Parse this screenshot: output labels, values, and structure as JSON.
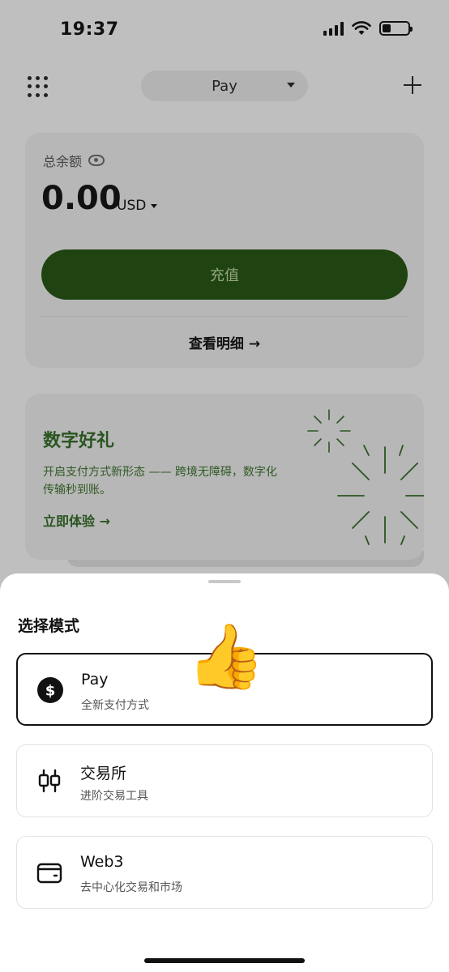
{
  "status_bar": {
    "time": "19:37"
  },
  "header": {
    "mode_label": "Pay"
  },
  "balance": {
    "label": "总余额",
    "amount": "0.00",
    "currency": "USD",
    "recharge_label": "充值",
    "details_label": "查看明细 →"
  },
  "promo": {
    "title": "数字好礼",
    "description": "开启支付方式新形态 —— 跨境无障碍，数字化传输秒到账。",
    "cta": "立即体验 →"
  },
  "sheet": {
    "title": "选择模式",
    "options": [
      {
        "title": "Pay",
        "subtitle": "全新支付方式",
        "icon": "dollar-circle-icon",
        "selected": true
      },
      {
        "title": "交易所",
        "subtitle": "进阶交易工具",
        "icon": "candlestick-icon",
        "selected": false
      },
      {
        "title": "Web3",
        "subtitle": "去中心化交易和市场",
        "icon": "wallet-icon",
        "selected": false
      }
    ]
  },
  "colors": {
    "accent_green": "#1f4412",
    "promo_green": "#2a5520"
  },
  "emoji": "👍"
}
